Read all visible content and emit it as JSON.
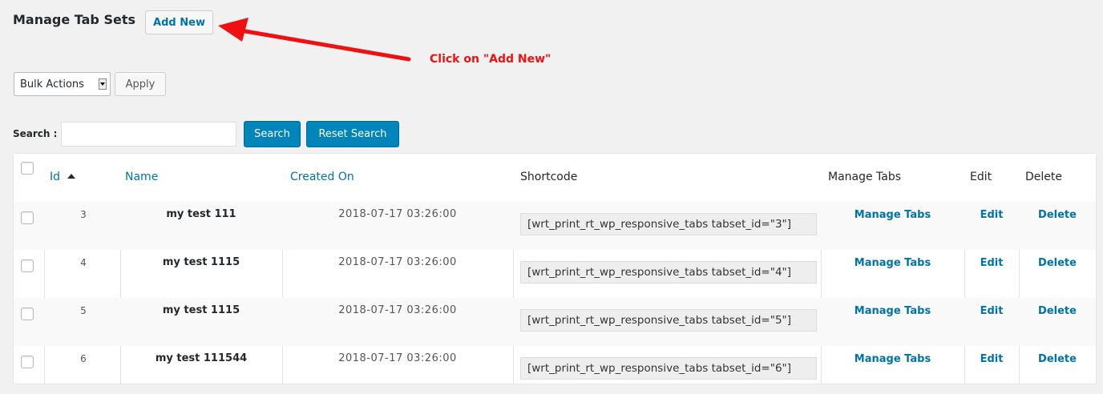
{
  "page": {
    "title": "Manage Tab Sets",
    "add_new_label": "Add New"
  },
  "annotation": {
    "text": "Click on \"Add New\"",
    "color": "#ee1111"
  },
  "bulk": {
    "selected": "Bulk Actions",
    "apply_label": "Apply"
  },
  "search": {
    "label": "Search :",
    "value": "",
    "search_label": "Search",
    "reset_label": "Reset Search"
  },
  "table": {
    "headers": {
      "id": "Id",
      "name": "Name",
      "created_on": "Created On",
      "shortcode": "Shortcode",
      "manage_tabs": "Manage Tabs",
      "edit": "Edit",
      "delete": "Delete"
    },
    "rows": [
      {
        "id": "3",
        "name": "my test 111",
        "created_on": "2018-07-17 03:26:00",
        "shortcode": "[wrt_print_rt_wp_responsive_tabs tabset_id=\"3\"]",
        "manage": "Manage Tabs",
        "edit": "Edit",
        "delete": "Delete"
      },
      {
        "id": "4",
        "name": "my test 1115",
        "created_on": "2018-07-17 03:26:00",
        "shortcode": "[wrt_print_rt_wp_responsive_tabs tabset_id=\"4\"]",
        "manage": "Manage Tabs",
        "edit": "Edit",
        "delete": "Delete"
      },
      {
        "id": "5",
        "name": "my test 1115",
        "created_on": "2018-07-17 03:26:00",
        "shortcode": "[wrt_print_rt_wp_responsive_tabs tabset_id=\"5\"]",
        "manage": "Manage Tabs",
        "edit": "Edit",
        "delete": "Delete"
      },
      {
        "id": "6",
        "name": "my test 111544",
        "created_on": "2018-07-17 03:26:00",
        "shortcode": "[wrt_print_rt_wp_responsive_tabs tabset_id=\"6\"]",
        "manage": "Manage Tabs",
        "edit": "Edit",
        "delete": "Delete"
      }
    ]
  },
  "colors": {
    "link": "#0073aa",
    "primary_button": "#0085ba",
    "background": "#f1f1f1"
  },
  "icons": [
    "arrow-annotation-icon",
    "sort-ascending-icon",
    "dropdown-caret-icon",
    "checkbox-icon"
  ]
}
